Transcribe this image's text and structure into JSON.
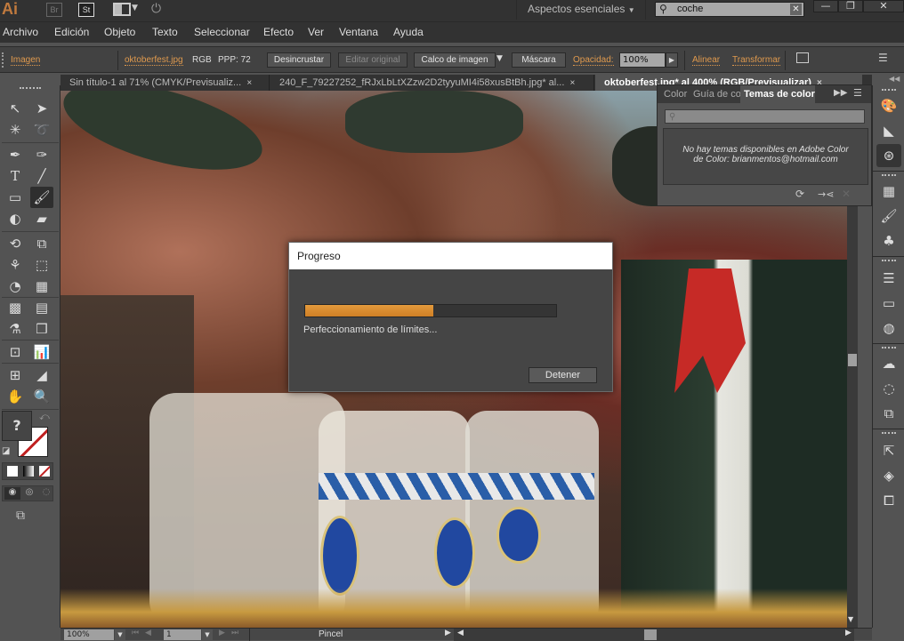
{
  "app": {
    "logo": "Ai",
    "bridge_label": "Br",
    "stock_label": "St",
    "workspace": "Aspectos esenciales",
    "search_value": "coche",
    "window_buttons": {
      "minimize": "—",
      "restore": "❐",
      "close": "✕"
    }
  },
  "menu": [
    "Archivo",
    "Edición",
    "Objeto",
    "Texto",
    "Seleccionar",
    "Efecto",
    "Ver",
    "Ventana",
    "Ayuda"
  ],
  "controlbar": {
    "object_type": "Imagen",
    "filename": "oktoberfest.jpg",
    "color_mode": "RGB",
    "ppi": "PPP: 72",
    "unembed": "Desincrustar",
    "edit_original": "Editar original",
    "image_trace": "Calco de imagen",
    "mask": "Máscara",
    "opacity_label": "Opacidad:",
    "opacity_value": "100%",
    "align": "Alinear",
    "transform": "Transformar"
  },
  "tabs": [
    {
      "label": "Sin título-1 al 71% (CMYK/Previsualiz...",
      "close": "×",
      "active": false
    },
    {
      "label": "240_F_79227252_fRJxLbLtXZzw2D2tyyuMI4i58xusBtBh.jpg* al...",
      "close": "×",
      "active": false
    },
    {
      "label": "oktoberfest.jpg* al 400% (RGB/Previsualizar)",
      "close": "×",
      "active": true
    }
  ],
  "color_panel": {
    "tabs": [
      "Color",
      "Guía de co",
      "Temas de color"
    ],
    "active_tab": "Temas de color",
    "search_placeholder": "",
    "message_line1": "No hay temas disponibles en Adobe Color",
    "message_line2": "de Color: brianmentos@hotmail.com"
  },
  "dialog": {
    "title": "Progreso",
    "progress": 0.51,
    "status": "Perfeccionamiento de límites...",
    "stop_button": "Detener"
  },
  "statusbar": {
    "zoom": "100%",
    "artboard": "1",
    "current_tool": "Pincel"
  },
  "colors": {
    "accent": "#e09a4e",
    "progress": "#dc8c30",
    "panel_bg": "#535353",
    "bar_bg": "#323232"
  }
}
